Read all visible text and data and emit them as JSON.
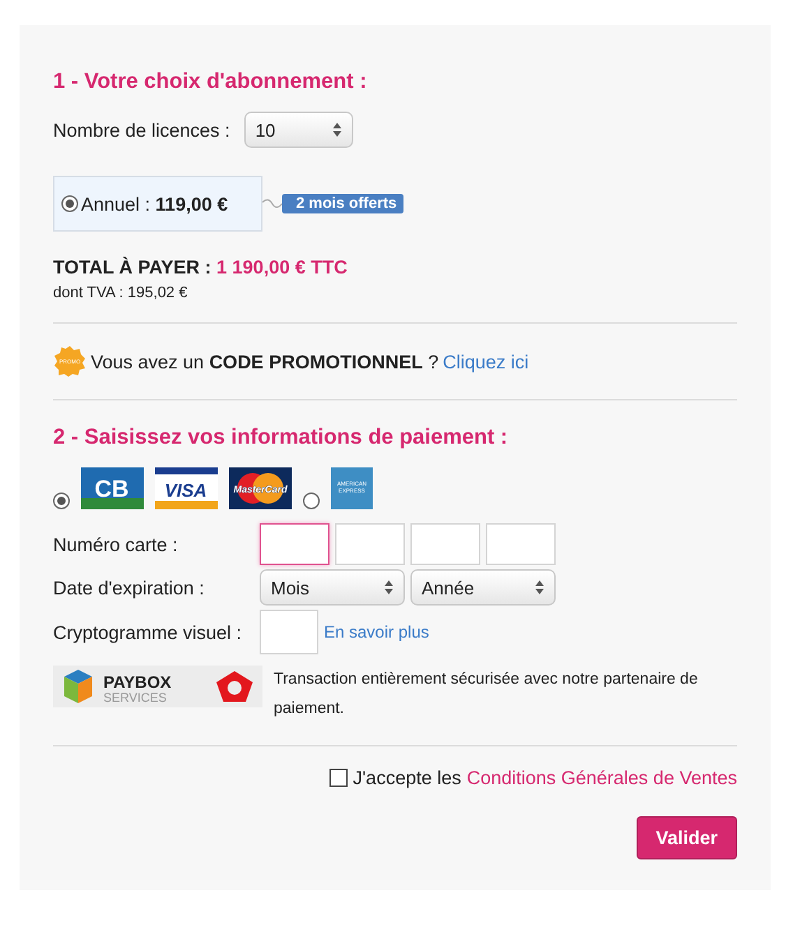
{
  "section1": {
    "title": "1 - Votre choix d'abonnement :"
  },
  "licences": {
    "label": "Nombre de licences :",
    "value": "10"
  },
  "plans": [
    {
      "label": "Annuel : ",
      "price": "119,00 €",
      "selected": true,
      "badge": "2 mois offerts"
    }
  ],
  "total": {
    "label": "TOTAL À PAYER : ",
    "amount": "1 190,00 €",
    "suffix": "TTC",
    "tva": "dont TVA : 195,02 €"
  },
  "promo": {
    "badge": "PROMO",
    "text": "Vous avez un **CODE PROMOTIONNEL** ?",
    "link": "Cliquez ici"
  },
  "section2": {
    "title": "2 - Saisissez vos informations de paiement :"
  },
  "payment_options": [
    {
      "selected": true,
      "logos": [
        {
          "kind": "cb",
          "label": "CB"
        },
        {
          "kind": "visa",
          "label": "VISA"
        },
        {
          "kind": "mastercard",
          "label": "MasterCard"
        }
      ]
    },
    {
      "selected": false,
      "logos": [
        {
          "kind": "amex",
          "lines": [
            "AMERICAN",
            "EXPRESS"
          ]
        }
      ]
    }
  ],
  "card_number": {
    "label": "Numéro carte :",
    "fields": [
      {
        "focused": true
      },
      {
        "focused": false
      },
      {
        "focused": false
      },
      {
        "focused": false
      }
    ]
  },
  "expiry": {
    "label": "Date d'expiration :",
    "month": "Mois",
    "year": "Année"
  },
  "cvv": {
    "label": "Cryptogramme visuel :",
    "link": "En savoir plus"
  },
  "security": {
    "brand": "PAYBOX",
    "brand_sub": "SERVICES",
    "text": "Transaction entièrement sécurisée avec notre partenaire de paiement."
  },
  "terms": {
    "checked": false,
    "text": "J'accepte les",
    "link": "Conditions Générales de Ventes"
  },
  "submit": "Valider"
}
